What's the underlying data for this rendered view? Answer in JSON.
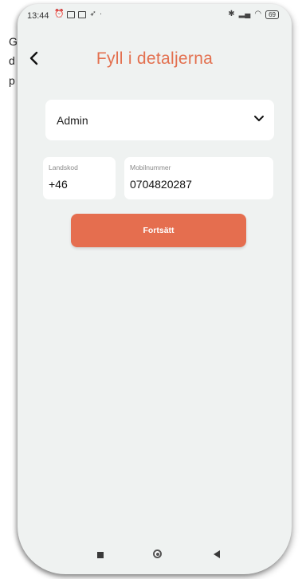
{
  "background_text": [
    "G",
    "d",
    "p"
  ],
  "status_bar": {
    "time": "13:44",
    "battery": "69",
    "icons_left": [
      "alarm-icon",
      "message-icon",
      "calendar-icon",
      "bird-icon"
    ],
    "icons_right": [
      "bluetooth-icon",
      "signal-icon",
      "wifi-icon",
      "battery-icon"
    ]
  },
  "header": {
    "title": "Fyll i detaljerna"
  },
  "form": {
    "role_value": "Admin",
    "country_code_label": "Landskod",
    "country_code_value": "+46",
    "mobile_label": "Mobilnummer",
    "mobile_value": "0704820287",
    "submit_label": "Fortsätt"
  },
  "colors": {
    "accent": "#e3704f",
    "button": "#e56e4f",
    "screen_bg": "#eff2f1"
  }
}
